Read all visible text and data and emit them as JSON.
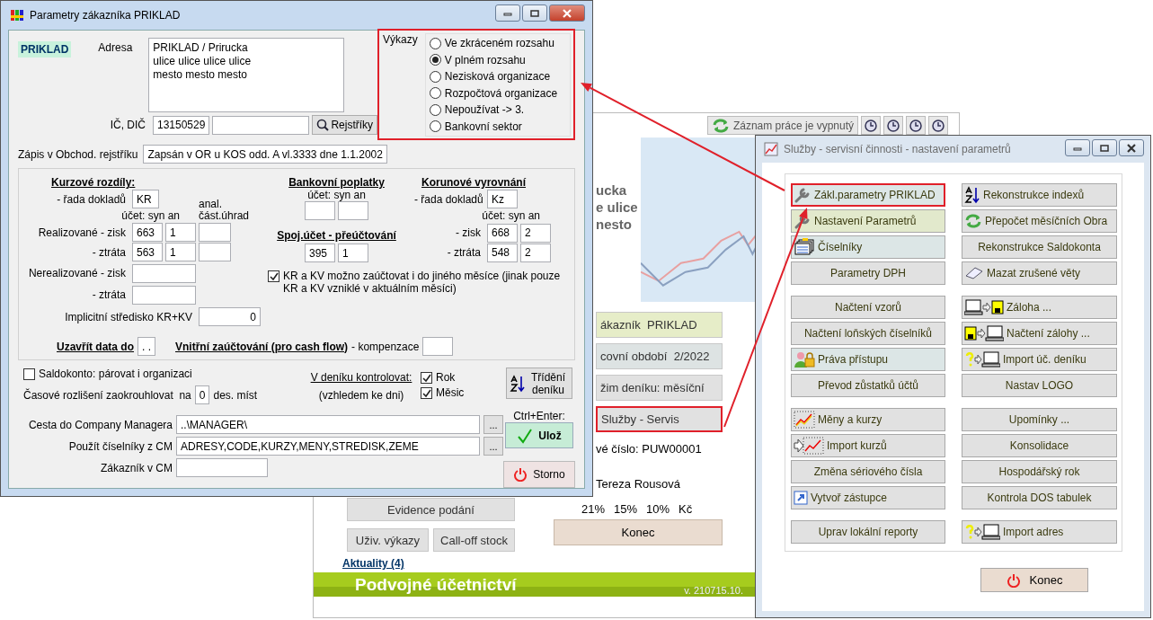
{
  "main_window": {
    "status_button": "Záznam práce je vypnutý",
    "company_lines": [
      "ucka",
      "e ulice",
      "nesto"
    ],
    "info_buttons": [
      {
        "label": "ákazník  PRIKLAD",
        "color": "#e6edc8",
        "highlighted": false
      },
      {
        "label": "covní období  2/2022",
        "color": "#dde3e3",
        "highlighted": false
      },
      {
        "label": "žim deníku: měsíční",
        "color": "#e1e1e1",
        "highlighted": false
      },
      {
        "label": "Služby - Servis",
        "color": "#e1e1e1",
        "highlighted": true
      }
    ],
    "serial": "vé číslo: PUW00001",
    "user": "Tereza Rousová",
    "vat_rates": [
      "21%",
      "15%",
      "10%",
      "Kč"
    ],
    "left_buttons": [
      "Evidence podání",
      "Uživ. výkazy",
      "Call-off stock"
    ],
    "exit_button": "Konec",
    "news_link": "Aktuality (4)",
    "product_name": "Podvojné účetnictví",
    "version": "v. 210715.10."
  },
  "param_dialog": {
    "title": "Parametry zákazníka PRIKLAD",
    "customer_code": "PRIKLAD",
    "address_label": "Adresa",
    "address_lines": [
      "PRIKLAD / Prirucka",
      "ulice ulice ulice ulice",
      "mesto mesto mesto"
    ],
    "ic_dic_label": "IČ, DIČ",
    "ic": "13150529",
    "registers_button": "Rejstříky",
    "register_label": "Zápis v Obchod. rejstříku",
    "register_entry": "Zapsán v OR u KOS odd. A vl.3333 dne 1.1.2002",
    "reports": {
      "label": "Výkazy",
      "highlighted": true,
      "options": [
        {
          "label": "Ve zkráceném rozsahu",
          "selected": false
        },
        {
          "label": "V plném rozsahu",
          "selected": true
        },
        {
          "label": "Nezisková organizace",
          "selected": false
        },
        {
          "label": "Rozpočtová organizace",
          "selected": false
        },
        {
          "label": "Nepoužívat -> 3.",
          "selected": false
        },
        {
          "label": "Bankovní sektor",
          "selected": false
        }
      ]
    },
    "exchange": {
      "heading": "Kurzové rozdíly:",
      "series_label": "- řada dokladů",
      "series": "KR",
      "account_label": "účet: syn an",
      "analytic_label": [
        "anal.",
        "část.úhrad"
      ],
      "rows": [
        {
          "kind": "realized",
          "label": "Realizované - zisk",
          "syn": "663",
          "an": "1"
        },
        {
          "kind": "realized",
          "label": "- ztráta",
          "syn": "563",
          "an": "1"
        },
        {
          "kind": "unrealized",
          "label": "Nerealizované - zisk"
        },
        {
          "kind": "unrealized",
          "label": "- ztráta"
        }
      ],
      "center_label": "Implicitní středisko KR+KV",
      "center": "0"
    },
    "bank_fees": {
      "heading": "Bankovní poplatky",
      "account_label": "účet: syn an",
      "transfer_heading": "Spoj.účet - přeúčtování",
      "transfer_syn": "395",
      "transfer_an": "1"
    },
    "rounding": {
      "heading": "Korunové vyrovnání",
      "series_label": "- řada dokladů",
      "series": "Kz",
      "account_label": "účet: syn an",
      "rows": [
        {
          "label": "- zisk",
          "syn": "668",
          "an": "2"
        },
        {
          "label": "- ztráta",
          "syn": "548",
          "an": "2"
        }
      ]
    },
    "other_month": {
      "label": "KR a KV možno zaúčtovat i do jiného měsíce (jinak pouze KR a KV vzniklé v aktuálním měsíci)",
      "checked": true
    },
    "close_label": "Uzavřít data do",
    "close_date": ". .",
    "internal_label": "Vnitřní zaúčtování (pro cash flow)",
    "compensation_label": "- kompenzace",
    "saldokonto": {
      "label": "Saldokonto: párovat i organizaci",
      "checked": false
    },
    "rounding_places": {
      "label": "Časové rozlišení zaokrouhlovat  na",
      "value": "0",
      "unit": "des. míst"
    },
    "journal_check": {
      "label": "V deníku kontrolovat:",
      "note": "(vzhledem ke dni)",
      "options": [
        {
          "label": "Rok",
          "checked": true
        },
        {
          "label": "Měsic",
          "checked": true
        }
      ]
    },
    "sort_button": "Třídění deníku",
    "shortcut_hint": "Ctrl+Enter:",
    "save_button": "Ulož",
    "cancel_button": "Storno",
    "paths": [
      {
        "label": "Cesta do Company Managera",
        "value": "..\\MANAGER\\",
        "browse": "..."
      },
      {
        "label": "Použít číselníky z CM",
        "value": "ADRESY,CODE,KURZY,MENY,STREDISK,ZEME",
        "browse": "..."
      },
      {
        "label": "Zákazník v CM"
      }
    ]
  },
  "services_dialog": {
    "title": "Služby - servisní činnosti - nastavení parametrů",
    "groups": [
      {
        "left": [
          {
            "label": "Zákl.parametry PRIKLAD",
            "kind": "wrench",
            "color": "#dce6e6",
            "highlighted": true
          },
          {
            "label": "Nastavení Parametrů",
            "kind": "wrench",
            "color": "#e2e9cc",
            "highlighted": false
          },
          {
            "label": "Číselníky",
            "kind": "catalog",
            "color": "#dce6e6",
            "highlighted": false
          },
          {
            "label": "Parametry DPH",
            "kind": "plain",
            "color": "#e1e1e1",
            "highlighted": false
          }
        ],
        "right": [
          {
            "label": "Rekonstrukce indexů",
            "kind": "sort",
            "color": "#e1e1e1",
            "highlighted": false
          },
          {
            "label": "Přepočet měsíčních Obra",
            "kind": "refresh",
            "color": "#e1e1e1",
            "highlighted": false
          },
          {
            "label": "Rekonstrukce Saldokonta",
            "kind": "plain",
            "color": "#e1e1e1",
            "highlighted": false
          },
          {
            "label": "Mazat zrušené věty",
            "kind": "eraser",
            "color": "#e1e1e1",
            "highlighted": false
          }
        ]
      },
      {
        "left": [
          {
            "label": "Načtení vzorů",
            "kind": "plain",
            "color": "#e1e1e1",
            "highlighted": false
          },
          {
            "label": "Načtení loňských číselníků",
            "kind": "plain",
            "color": "#e1e1e1",
            "highlighted": false
          },
          {
            "label": "Práva přístupu",
            "kind": "users",
            "color": "#dce6e6",
            "highlighted": false
          },
          {
            "label": "Převod zůstatků účtů",
            "kind": "plain",
            "color": "#e1e1e1",
            "highlighted": false
          }
        ],
        "right": [
          {
            "label": "Záloha ...",
            "kind": "backup",
            "color": "#e1e1e1",
            "highlighted": false
          },
          {
            "label": "Načtení zálohy ...",
            "kind": "restore",
            "color": "#e1e1e1",
            "highlighted": false
          },
          {
            "label": "Import úč. deníku",
            "kind": "import",
            "color": "#e1e1e1",
            "highlighted": false
          },
          {
            "label": "Nastav LOGO",
            "kind": "plain",
            "color": "#e1e1e1",
            "highlighted": false
          }
        ]
      },
      {
        "left": [
          {
            "label": "Měny a kurzy",
            "kind": "rates",
            "color": "#e1e1e1",
            "highlighted": false
          },
          {
            "label": "Import kurzů",
            "kind": "ratesimport",
            "color": "#e1e1e1",
            "highlighted": false
          },
          {
            "label": "Změna sériového čísla",
            "kind": "plain",
            "color": "#e1e1e1",
            "highlighted": false
          },
          {
            "label": "Vytvoř zástupce",
            "kind": "shortcut",
            "color": "#e1e1e1",
            "highlighted": false
          }
        ],
        "right": [
          {
            "label": "Upomínky ...",
            "kind": "plain",
            "color": "#e1e1e1",
            "highlighted": false
          },
          {
            "label": "Konsolidace",
            "kind": "plain",
            "color": "#e1e1e1",
            "highlighted": false
          },
          {
            "label": "Hospodářský rok",
            "kind": "plain",
            "color": "#e1e1e1",
            "highlighted": false
          },
          {
            "label": "Kontrola DOS tabulek",
            "kind": "plain",
            "color": "#e1e1e1",
            "highlighted": false
          }
        ]
      },
      {
        "left": [
          {
            "label": "Uprav lokální reporty",
            "kind": "plain",
            "color": "#e1e1e1",
            "highlighted": false
          }
        ],
        "right": [
          {
            "label": "Import adres",
            "kind": "import",
            "color": "#e1e1e1",
            "highlighted": false
          }
        ]
      }
    ],
    "exit_button": "Konec"
  }
}
